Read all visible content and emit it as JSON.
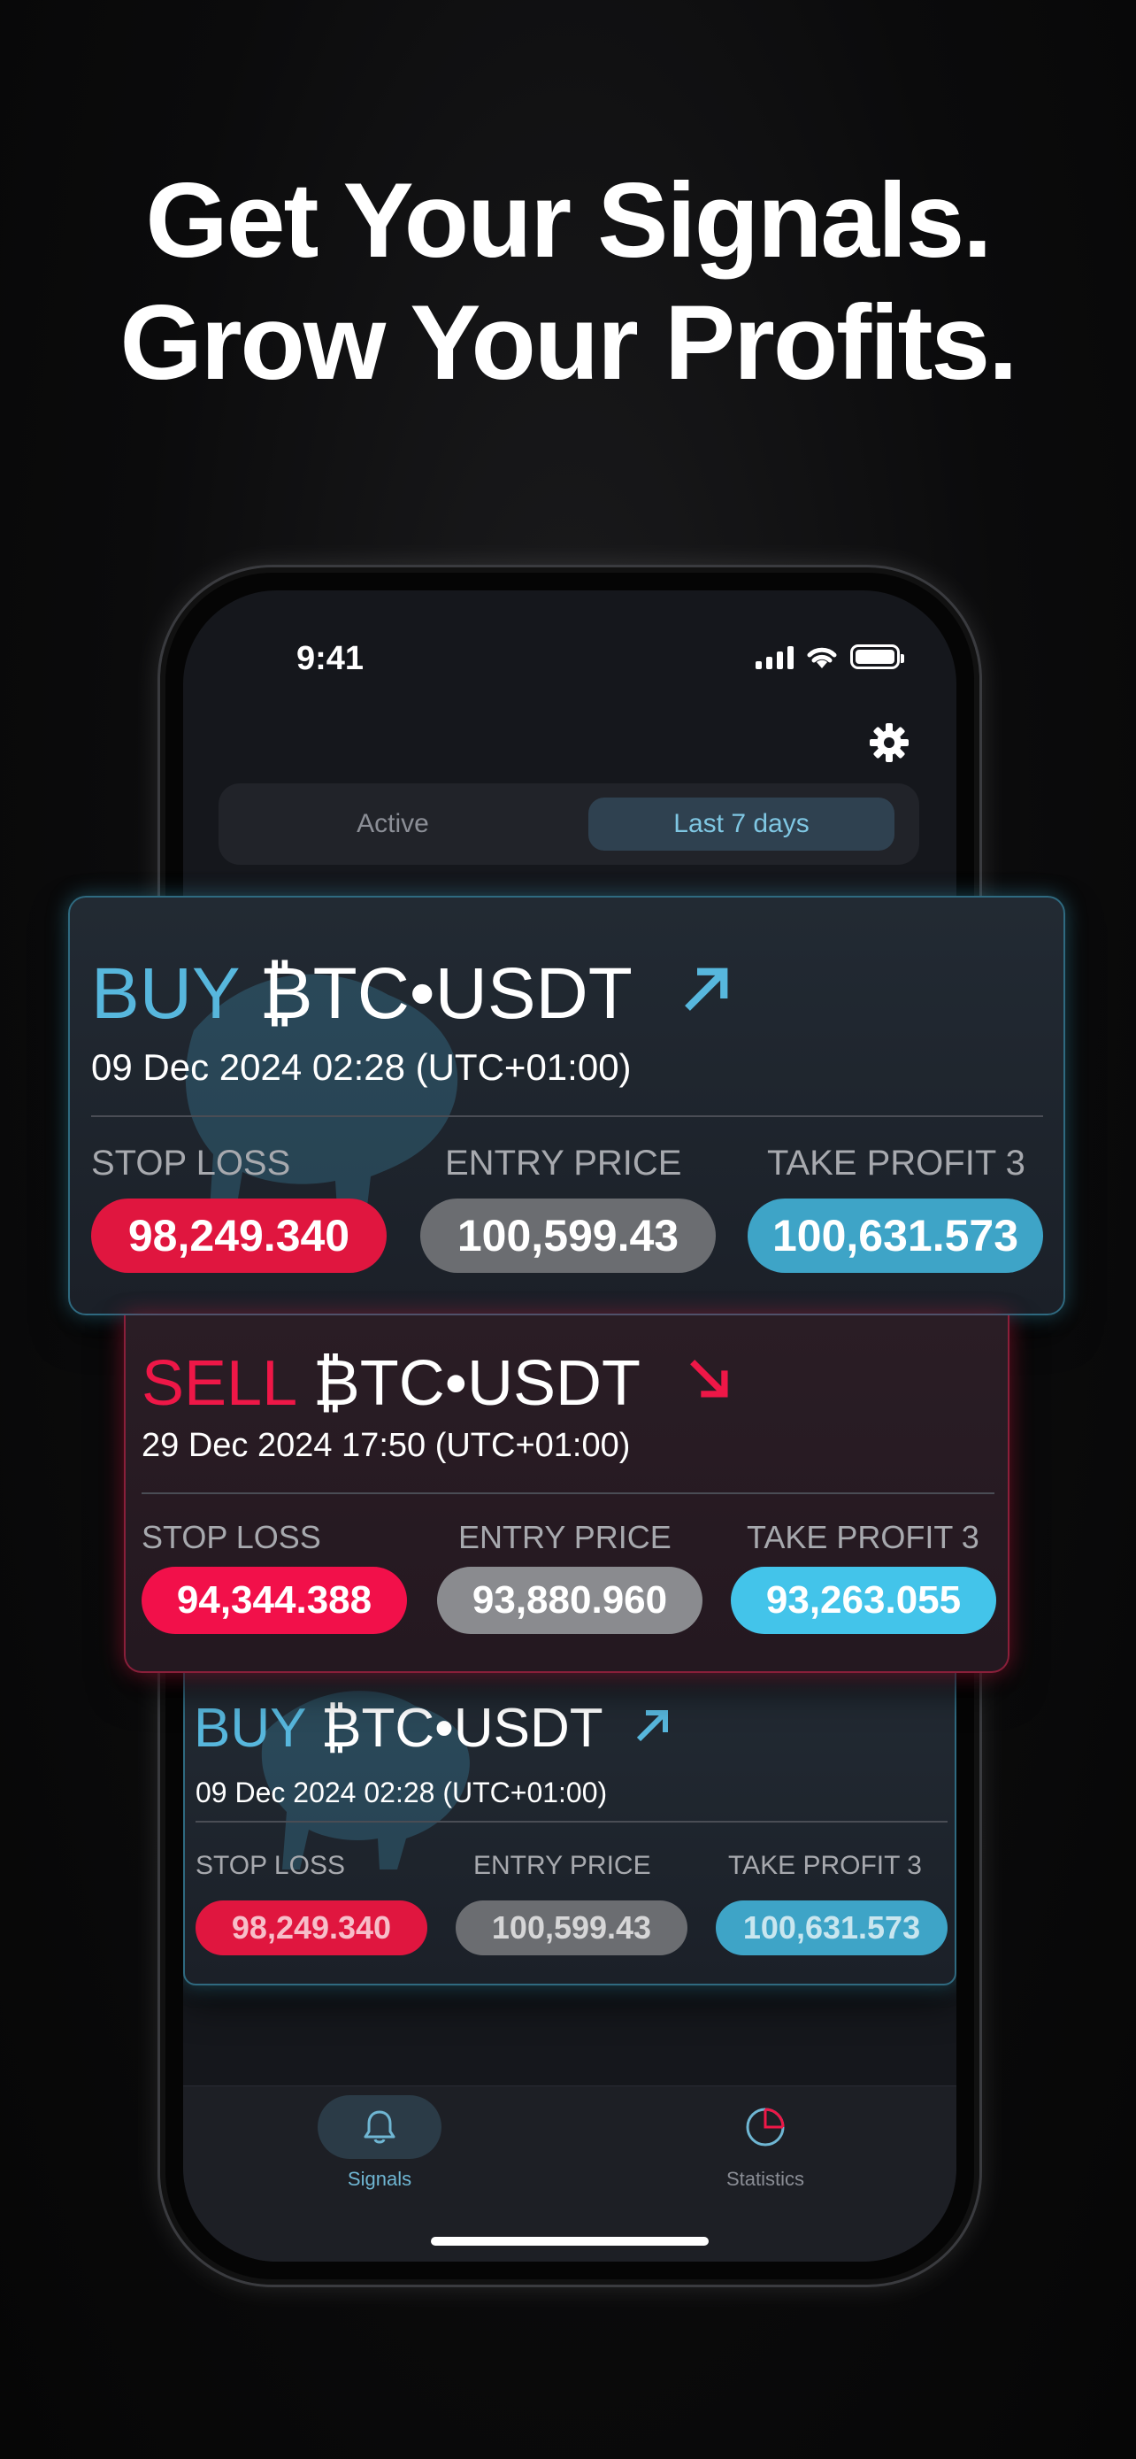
{
  "headline": {
    "line1": "Get Your Signals.",
    "line2": "Grow Your Profits."
  },
  "status_bar": {
    "time": "9:41"
  },
  "tabs": {
    "active": "Active",
    "last7": "Last 7 days",
    "selected": "Last 7 days"
  },
  "labels": {
    "stop_loss": "STOP LOSS",
    "entry_price": "ENTRY PRICE",
    "take_profit": "TAKE PROFIT 3"
  },
  "signals": [
    {
      "side": "BUY",
      "pair": "₿TC•USDT",
      "date": "09 Dec 2024 02:28 (UTC+01:00)",
      "stop_loss": "98,249.340",
      "entry_price": "100,599.43",
      "take_profit": "100,631.573"
    },
    {
      "side": "SELL",
      "pair": "₿TC•USDT",
      "date": "29 Dec 2024 17:50 (UTC+01:00)",
      "stop_loss": "94,344.388",
      "entry_price": "93,880.960",
      "take_profit": "93,263.055"
    },
    {
      "side": "BUY",
      "pair": "₿TC•USDT",
      "date": "09 Dec 2024 02:28 (UTC+01:00)",
      "stop_loss": "98,249.340",
      "entry_price": "100,599.43",
      "take_profit": "100,631.573"
    }
  ],
  "bottom_nav": {
    "signals": "Signals",
    "statistics": "Statistics"
  },
  "colors": {
    "buy": "#57b7dd",
    "sell": "#ee1747",
    "background": "#0b0b0c"
  }
}
